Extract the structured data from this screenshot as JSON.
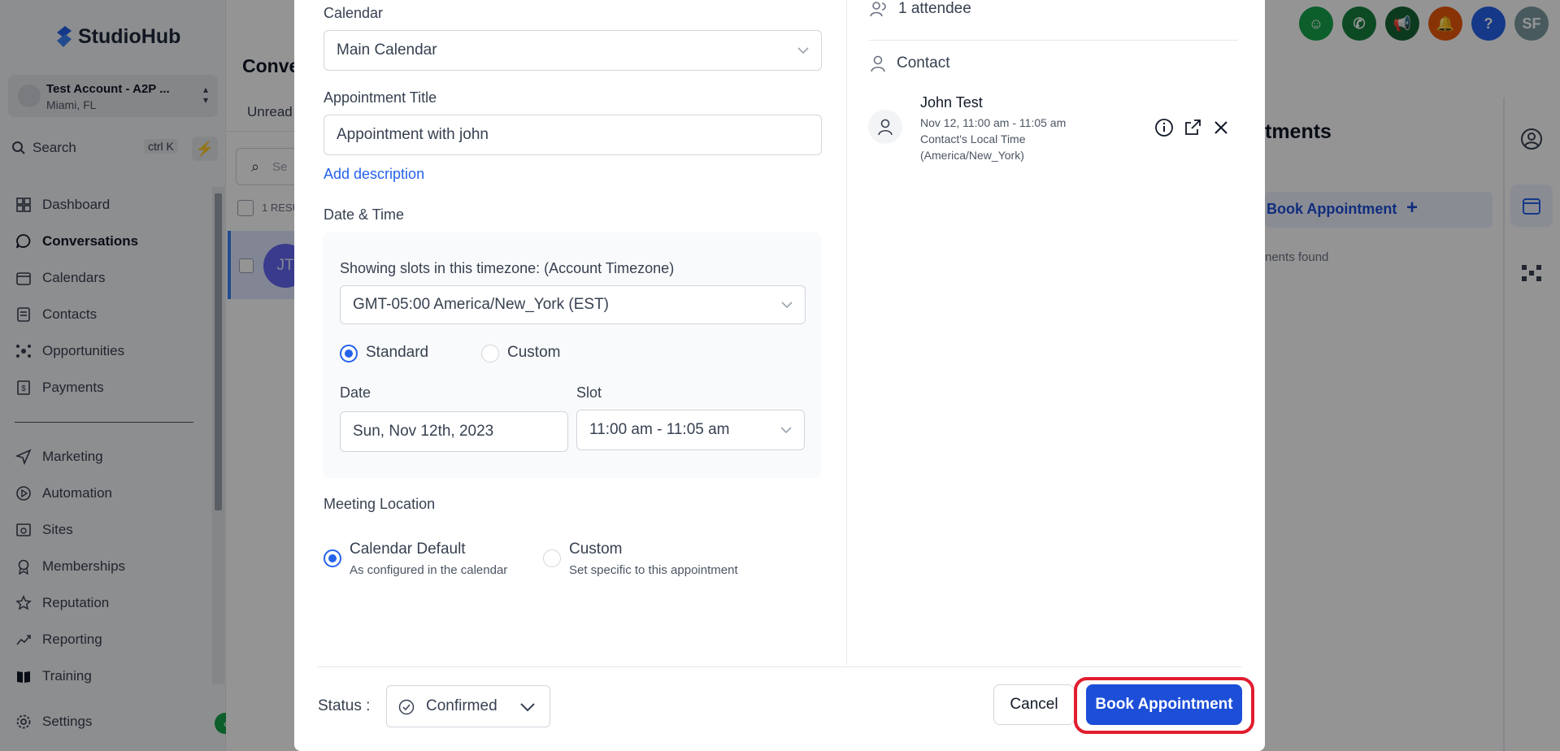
{
  "app": {
    "logo_text": "StudioHub",
    "account": {
      "name": "Test Account - A2P ...",
      "location": "Miami, FL"
    },
    "search": {
      "label": "Search",
      "shortcut": "ctrl K"
    }
  },
  "sidebar": {
    "items": [
      {
        "label": "Dashboard",
        "icon": "dashboard-icon"
      },
      {
        "label": "Conversations",
        "icon": "chat-icon",
        "active": true
      },
      {
        "label": "Calendars",
        "icon": "calendar-icon"
      },
      {
        "label": "Contacts",
        "icon": "contacts-icon"
      },
      {
        "label": "Opportunities",
        "icon": "opportunities-icon"
      },
      {
        "label": "Payments",
        "icon": "payments-icon"
      },
      {
        "label": "Marketing",
        "icon": "send-icon"
      },
      {
        "label": "Automation",
        "icon": "automation-icon"
      },
      {
        "label": "Sites",
        "icon": "sites-icon"
      },
      {
        "label": "Memberships",
        "icon": "memberships-icon"
      },
      {
        "label": "Reputation",
        "icon": "star-icon"
      },
      {
        "label": "Reporting",
        "icon": "chart-line-icon"
      },
      {
        "label": "Training",
        "icon": "book-icon"
      }
    ],
    "settings_label": "Settings"
  },
  "conversations": {
    "title": "Conve",
    "tab_unread": "Unread",
    "search_placeholder": "Se",
    "results_label": "1 RESU",
    "row_initials": "JT"
  },
  "topbar": {
    "user_initials": "SF"
  },
  "right_panel": {
    "title": "tments",
    "book_label": "Book Appointment",
    "empty_text": "nents found"
  },
  "modal": {
    "calendar_label": "Calendar",
    "calendar_value": "Main Calendar",
    "title_label": "Appointment Title",
    "title_value": "Appointment with john",
    "add_description": "Add description",
    "datetime_label": "Date & Time",
    "timezone_label": "Showing slots in this timezone: (Account Timezone)",
    "timezone_value": "GMT-05:00 America/New_York (EST)",
    "slot_mode_standard": "Standard",
    "slot_mode_custom": "Custom",
    "date_label": "Date",
    "date_value": "Sun, Nov 12th, 2023",
    "slot_label": "Slot",
    "slot_value": "11:00 am - 11:05 am",
    "location_label": "Meeting Location",
    "location_default_title": "Calendar Default",
    "location_default_sub": "As configured in the calendar",
    "location_custom_title": "Custom",
    "location_custom_sub": "Set specific to this appointment",
    "attendees_label": "1 attendee",
    "contact_section_label": "Contact",
    "contact": {
      "name": "John Test",
      "time": "Nov 12, 11:00 am - 11:05 am",
      "local_time_label": "Contact's Local Time",
      "local_tz": "(America/New_York)"
    },
    "status_label": "Status :",
    "status_value": "Confirmed",
    "cancel_label": "Cancel",
    "book_label": "Book Appointment"
  }
}
